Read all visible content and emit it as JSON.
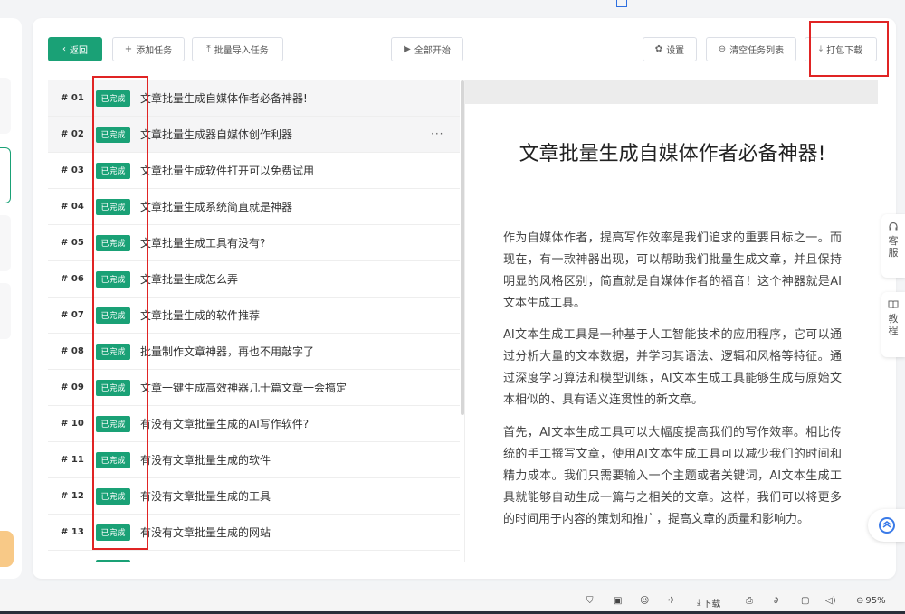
{
  "toolbar": {
    "back_label": "返回",
    "add_task_label": "添加任务",
    "batch_import_label": "批量导入任务",
    "start_all_label": "全部开始",
    "settings_label": "设置",
    "clear_list_label": "清空任务列表",
    "download_label": "打包下载"
  },
  "tasks": [
    {
      "num": "# 01",
      "status": "已完成",
      "title": "文章批量生成自媒体作者必备神器!"
    },
    {
      "num": "# 02",
      "status": "已完成",
      "title": "文章批量生成器自媒体创作利器"
    },
    {
      "num": "# 03",
      "status": "已完成",
      "title": "文章批量生成软件打开可以免费试用"
    },
    {
      "num": "# 04",
      "status": "已完成",
      "title": "文章批量生成系统简直就是神器"
    },
    {
      "num": "# 05",
      "status": "已完成",
      "title": "文章批量生成工具有没有?"
    },
    {
      "num": "# 06",
      "status": "已完成",
      "title": "文章批量生成怎么弄"
    },
    {
      "num": "# 07",
      "status": "已完成",
      "title": "文章批量生成的软件推荐"
    },
    {
      "num": "# 08",
      "status": "已完成",
      "title": "批量制作文章神器，再也不用敲字了"
    },
    {
      "num": "# 09",
      "status": "已完成",
      "title": "文章一键生成高效神器几十篇文章一会搞定"
    },
    {
      "num": "# 10",
      "status": "已完成",
      "title": "有没有文章批量生成的AI写作软件?"
    },
    {
      "num": "# 11",
      "status": "已完成",
      "title": "有没有文章批量生成的软件"
    },
    {
      "num": "# 12",
      "status": "已完成",
      "title": "有没有文章批量生成的工具"
    },
    {
      "num": "# 13",
      "status": "已完成",
      "title": "有没有文章批量生成的网站"
    }
  ],
  "row_more": "···",
  "preview": {
    "title": "文章批量生成自媒体作者必备神器!",
    "paragraphs": [
      "作为自媒体作者，提高写作效率是我们追求的重要目标之一。而现在，有一款神器出现，可以帮助我们批量生成文章，并且保持明显的风格区别，简直就是自媒体作者的福音！这个神器就是AI文本生成工具。",
      "AI文本生成工具是一种基于人工智能技术的应用程序，它可以通过分析大量的文本数据，并学习其语法、逻辑和风格等特征。通过深度学习算法和模型训练，AI文本生成工具能够生成与原始文本相似的、具有语义连贯性的新文章。",
      "首先，AI文本生成工具可以大幅度提高我们的写作效率。相比传统的手工撰写文章，使用AI文本生成工具可以减少我们的时间和精力成本。我们只需要输入一个主题或者关键词，AI文本生成工具就能够自动生成一篇与之相关的文章。这样，我们可以将更多的时间用于内容的策划和推广，提高文章的质量和影响力。"
    ]
  },
  "side_tabs": {
    "service": [
      "客",
      "服"
    ],
    "tutorial": [
      "教",
      "程"
    ]
  },
  "statusbar": {
    "download_label": "下载",
    "zoom": "95%"
  },
  "colors": {
    "accent": "#1aa176",
    "highlight": "#e02424"
  }
}
